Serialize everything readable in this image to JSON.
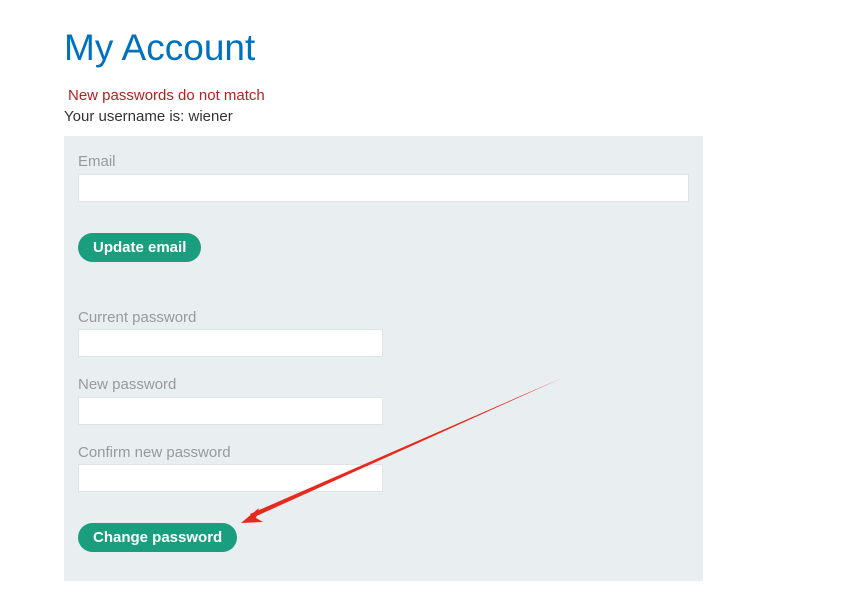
{
  "header": {
    "title": "My Account"
  },
  "messages": {
    "error": "New passwords do not match",
    "username": "Your username is: wiener"
  },
  "email_form": {
    "email_label": "Email",
    "email_value": "",
    "update_button": "Update email"
  },
  "password_form": {
    "current_label": "Current password",
    "current_value": "",
    "new_label": "New password",
    "new_value": "",
    "confirm_label": "Confirm new password",
    "confirm_value": "",
    "change_button": "Change password"
  },
  "colors": {
    "title": "#0071bc",
    "error": "#b22222",
    "panel_bg": "#e9eef1",
    "button_bg": "#1a9e7e",
    "annotation_arrow": "#e8281c"
  }
}
